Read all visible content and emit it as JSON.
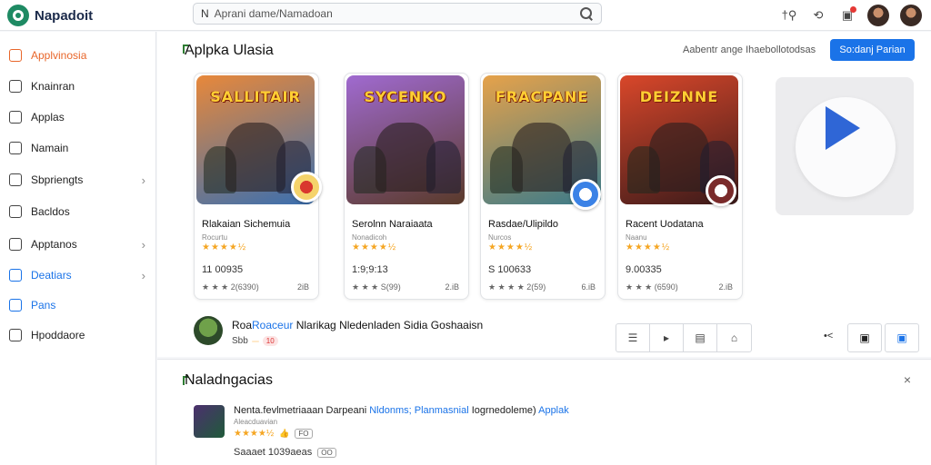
{
  "app": {
    "brand": "Napadoit"
  },
  "search": {
    "placeholder": "Aprani dame/Namadoan",
    "caret": "N"
  },
  "top_icons": [
    "settings-icon",
    "bell-icon",
    "notification-icon",
    "avatar",
    "avatar"
  ],
  "top_icon_glyphs": {
    "settings": "†⚲",
    "bell": "⟲",
    "notification": "▣"
  },
  "sidebar": {
    "items": [
      {
        "label": "Applvinosia",
        "state": "active",
        "icon": "grid-icon"
      },
      {
        "label": "Knainran",
        "icon": "book-icon"
      },
      {
        "label": "Applas",
        "icon": "check-square-icon"
      },
      {
        "label": "Namain",
        "icon": "folder-icon"
      },
      {
        "label": "Sbpriengts",
        "icon": "layers-icon",
        "chevron": "›"
      },
      {
        "label": "Bacldos",
        "icon": "clock-icon"
      },
      {
        "label": "Apptanos",
        "icon": "image-icon",
        "chevron": "›"
      },
      {
        "label": "Deatiars",
        "state": "blue",
        "icon": "search-icon",
        "chevron": "›"
      },
      {
        "label": "Pans",
        "state": "blue",
        "icon": "window-icon"
      },
      {
        "label": "Hpoddaore",
        "icon": "pin-icon"
      }
    ]
  },
  "section1": {
    "title": "Aplpka Ulasia",
    "hint": "Aabentr ange Ihaebollotodsas",
    "button": "So:danj Parian"
  },
  "cards": [
    {
      "art_text": "SALLITAIR",
      "name": "Rlakaian Sichemuia",
      "sub": "Rocurtu",
      "rating": "★★★★½",
      "count": "11 00935",
      "stats": "★ ★ ★ 2(6390)",
      "size": "2iB",
      "colors": [
        "#e8883a",
        "#3a6fb0"
      ],
      "badge_colors": [
        "#f5d36b",
        "#d9382e"
      ]
    },
    {
      "art_text": "SYCENKO",
      "name": "Serolnn Naraiaata",
      "sub": "Nonadicoh",
      "rating": "★★★★½",
      "count": "1:9;9:13",
      "stats": "★ ★ ★ S(99)",
      "size": "2.iB",
      "colors": [
        "#a06ad0",
        "#5a3a2a"
      ],
      "badge_colors": null
    },
    {
      "art_text": "FRACPANE",
      "name": "Rasdae/Ulipildo",
      "sub": "Nurcos",
      "rating": "★★★★½",
      "count": "S 100633",
      "stats": "★ ★ ★ ★ 2(59)",
      "size": "6.iB",
      "colors": [
        "#e6a24a",
        "#3a7a8a"
      ],
      "badge_colors": [
        "#3b82e6",
        "#ffffff"
      ]
    },
    {
      "art_text": "DEIZNNE",
      "name": "Racent Uodatana",
      "sub": "Naanu",
      "rating": "★★★★½",
      "count": "9.00335",
      "stats": "★ ★ ★ (6590)",
      "size": "2.iB",
      "colors": [
        "#d9472a",
        "#3a1a1a"
      ],
      "badge_colors": [
        "#7a2b2b",
        "#ffffff"
      ]
    }
  ],
  "promo": {
    "title_prefix": "Roa",
    "title_highlight": "Roaceur",
    "title_rest": "Nlarikag Nledenladen Sidia Goshaaisn",
    "sub_label": "Sbb",
    "chips": [
      "",
      "10"
    ]
  },
  "toolbar": {
    "tools": [
      "☰",
      "▸",
      "▤",
      "⌂"
    ],
    "share_glyph": "•<",
    "buttons": [
      "▣",
      "▣"
    ]
  },
  "section2": {
    "title": "Naladngacias",
    "close": "×",
    "item": {
      "title_prefix": "Nenta.fevlmetriaaan Darpeani",
      "title_highlight1": "Nldonms;",
      "title_highlight2": "Planmasnial",
      "title_rest": "Iogrnedoleme)",
      "title_highlight3": "Applak",
      "sub": "Aleacduavian",
      "rating": "★★★★½",
      "rating_glyph": "👍",
      "rating_tag": "FO",
      "foot": "Saaaet 1039aeas",
      "foot_tag": "OO"
    }
  },
  "colors": {
    "accent": "#1a73e8",
    "active": "#e8662a",
    "star": "#f5a623"
  }
}
